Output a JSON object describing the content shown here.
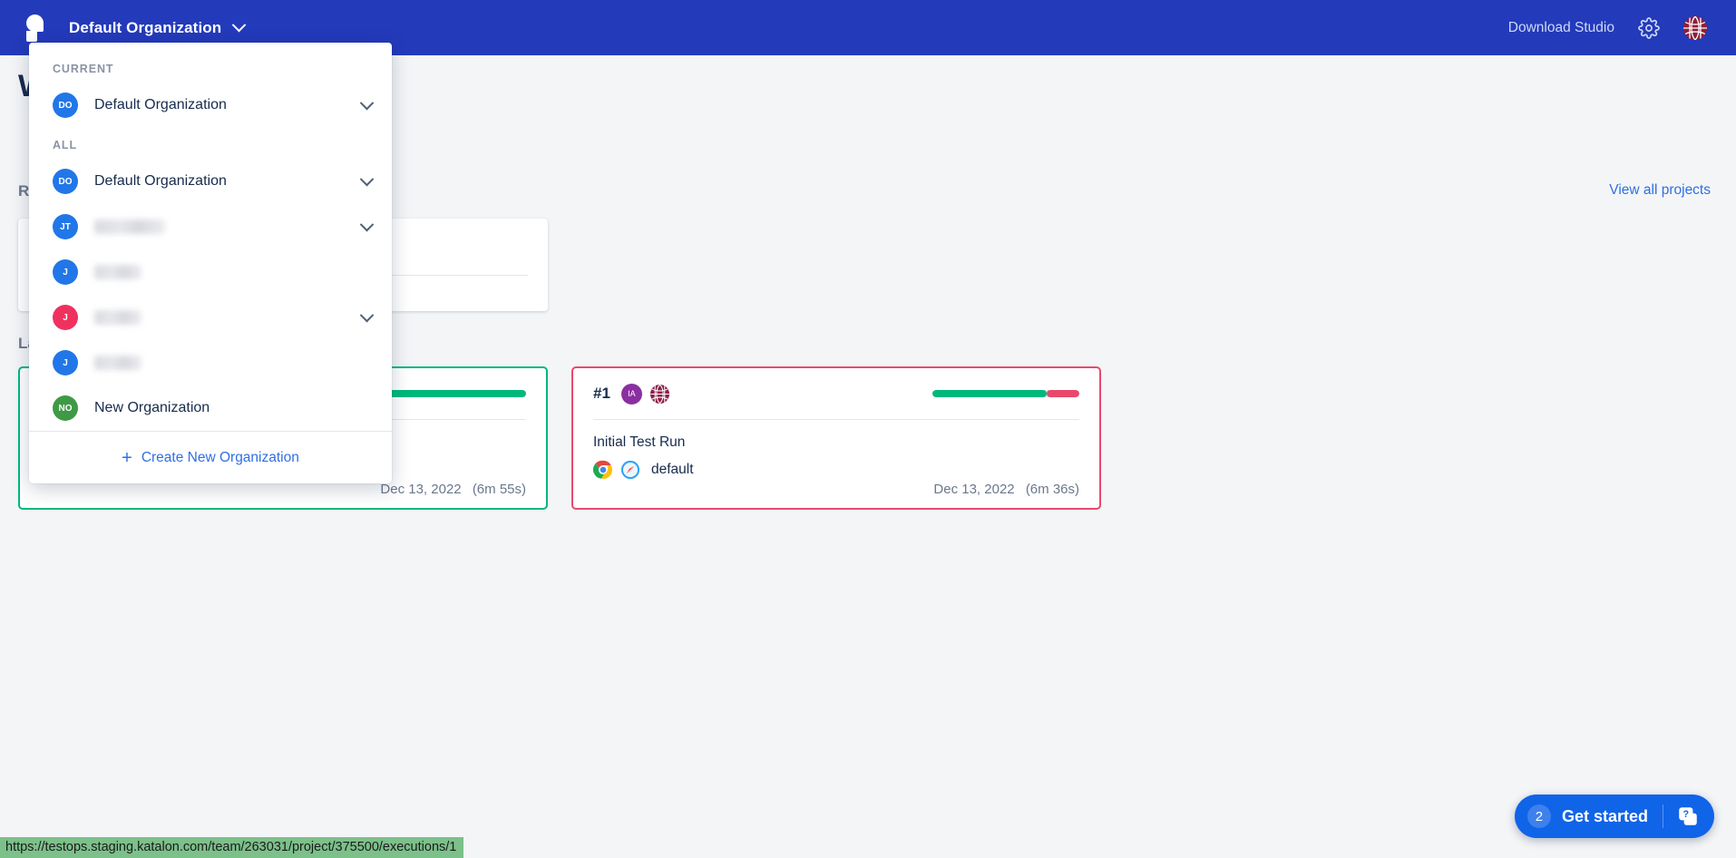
{
  "header": {
    "logo": "katalon-logo-icon",
    "org_name": "Default Organization",
    "chevron": "chevron-down-icon",
    "download_studio": "Download Studio",
    "settings_icon": "gear-icon",
    "avatar": "user-avatar"
  },
  "page": {
    "welcome_title": "W",
    "recent_label": "Re",
    "latest_label": "La",
    "view_all_projects": "View all projects"
  },
  "org_menu": {
    "current_label": "CURRENT",
    "all_label": "ALL",
    "current": [
      {
        "initials": "DO",
        "name": "Default Organization",
        "color": "#2177e8",
        "blurred": false,
        "has_chevron": true
      }
    ],
    "all": [
      {
        "initials": "DO",
        "name": "Default Organization",
        "color": "#2177e8",
        "blurred": false,
        "has_chevron": true
      },
      {
        "initials": "JT",
        "name": "",
        "color": "#2177e8",
        "blurred": true,
        "blur_width": 78,
        "has_chevron": true
      },
      {
        "initials": "J",
        "name": "",
        "color": "#2177e8",
        "blurred": true,
        "blur_width": 52,
        "has_chevron": false
      },
      {
        "initials": "J",
        "name": "",
        "color": "#f0315f",
        "blurred": true,
        "blur_width": 52,
        "has_chevron": true
      },
      {
        "initials": "J",
        "name": "",
        "color": "#2177e8",
        "blurred": true,
        "blur_width": 52,
        "has_chevron": false
      },
      {
        "initials": "NO",
        "name": "New Organization",
        "color": "#3f9a46",
        "blurred": false,
        "has_chevron": false
      }
    ],
    "create_label": "Create New Organization",
    "create_plus": "plus-icon"
  },
  "runs": [
    {
      "id": "",
      "status": "passed",
      "border_color": "#00b87c",
      "progress_color": "#00b87c",
      "progress_pct": 100,
      "title": "",
      "env": "",
      "date": "Dec 13, 2022",
      "duration": "(6m 55s)"
    },
    {
      "id": "#1",
      "status": "failed",
      "border_color": "#e8496b",
      "progress_color": "#00b87c",
      "progress_pct": 78,
      "fail_color": "#e8496b",
      "avatar_initials": "IA",
      "avatar_color": "#8b2fa0",
      "project_icon": "katalon-globe-icon",
      "title": "Initial Test Run",
      "browsers": [
        "chrome-icon",
        "safari-icon"
      ],
      "env": "default",
      "date": "Dec 13, 2022",
      "duration": "(6m 36s)"
    }
  ],
  "status_bar": {
    "url": "https://testops.staging.katalon.com/team/263031/project/375500/executions/1"
  },
  "get_started": {
    "count": "2",
    "label": "Get started",
    "icon": "help-chat-icon"
  }
}
